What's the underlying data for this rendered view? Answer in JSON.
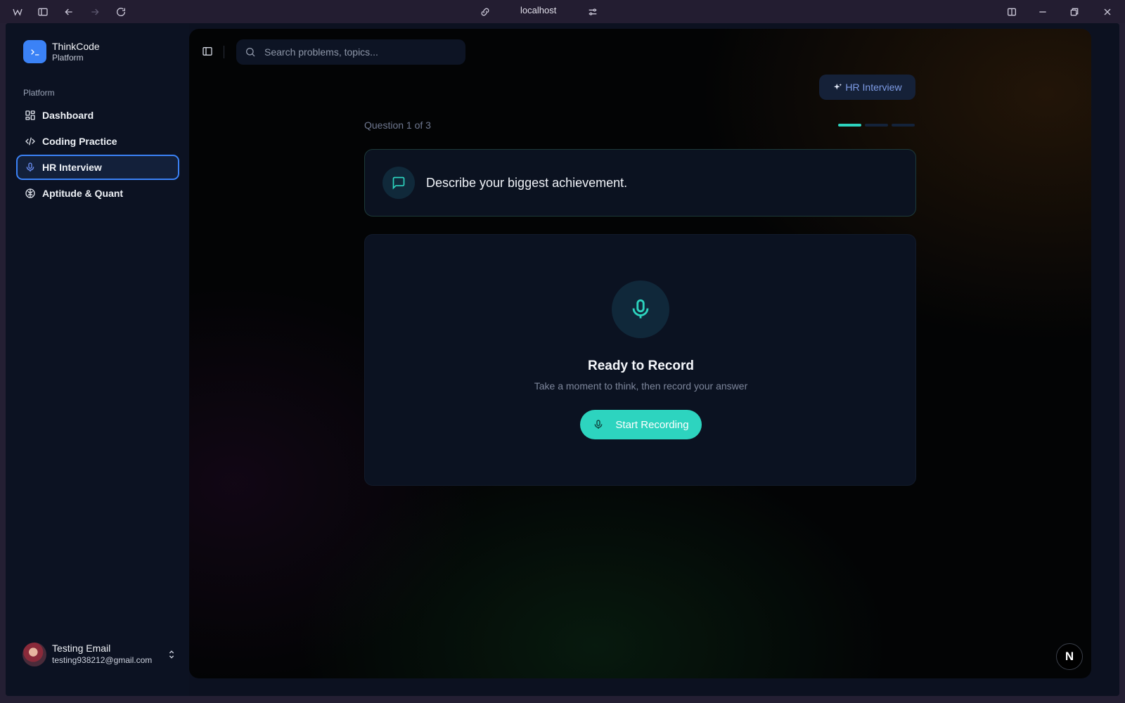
{
  "browser": {
    "url": "localhost"
  },
  "sidebar": {
    "brand_name": "ThinkCode",
    "brand_sub": "Platform",
    "section_label": "Platform",
    "items": [
      {
        "label": "Dashboard",
        "icon": "dashboard-icon",
        "active": false
      },
      {
        "label": "Coding Practice",
        "icon": "code-icon",
        "active": false
      },
      {
        "label": "HR Interview",
        "icon": "mic-icon",
        "active": true
      },
      {
        "label": "Aptitude & Quant",
        "icon": "brain-icon",
        "active": false
      }
    ],
    "user": {
      "name": "Testing Email",
      "email": "testing938212@gmail.com"
    }
  },
  "topbar": {
    "search_placeholder": "Search problems, topics..."
  },
  "main": {
    "badge_label": "HR Interview",
    "question_count": "Question 1 of 3",
    "progress": {
      "current": 1,
      "total": 3
    },
    "question_text": "Describe your biggest achievement.",
    "record": {
      "title": "Ready to Record",
      "subtitle": "Take a moment to think, then record your answer",
      "button_label": "Start Recording"
    },
    "corner_badge": "N"
  },
  "colors": {
    "accent": "#2dd4bf",
    "brand": "#3b82f6"
  }
}
